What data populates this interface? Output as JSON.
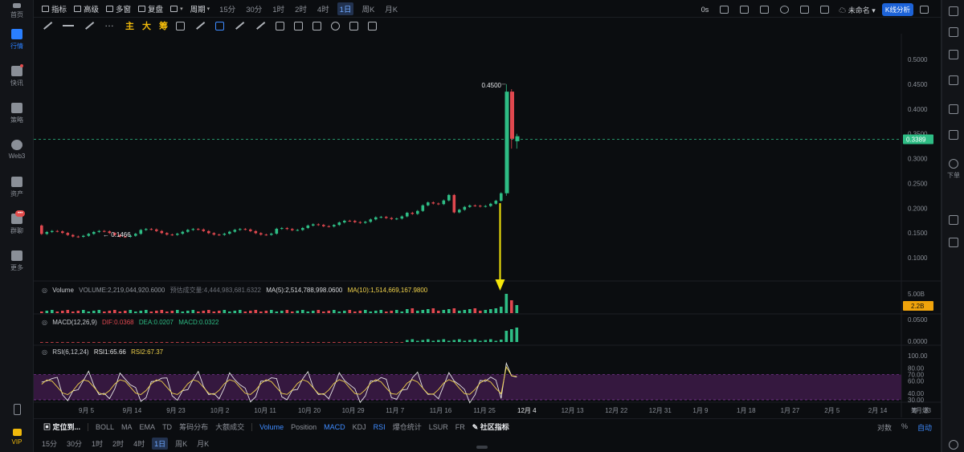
{
  "left_nav": [
    {
      "label": "首页",
      "icon": "home-icon"
    },
    {
      "label": "行情",
      "icon": "market-chart-icon",
      "active": true
    },
    {
      "label": "快讯",
      "icon": "news-icon"
    },
    {
      "label": "策略",
      "icon": "robot-icon"
    },
    {
      "label": "Web3",
      "icon": "web3-icon"
    },
    {
      "label": "资产",
      "icon": "wallet-icon"
    },
    {
      "label": "群聊",
      "icon": "chat-icon",
      "badge": "•••"
    },
    {
      "label": "更多",
      "icon": "more-grid-icon"
    },
    {
      "label": "VIP",
      "icon": "vip-crown-icon"
    }
  ],
  "toolbar": {
    "indicators": "指标",
    "advanced": "高级",
    "multi_window": "多窗",
    "replay": "复盘",
    "period": "周期",
    "timeframes": [
      "15分",
      "30分",
      "1时",
      "2时",
      "4时",
      "1日",
      "周K",
      "月K"
    ],
    "active_timeframe": "1日",
    "countdown": "0s",
    "cloud_label": "未命名",
    "kline_analysis": "K线分析"
  },
  "draw_toolbar": {
    "main": "主",
    "large": "大",
    "chips": "筹"
  },
  "right_rail": {
    "place_order": "下单"
  },
  "chart": {
    "price_axis": [
      "0.5000",
      "0.4500",
      "0.4000",
      "0.3500",
      "0.3000",
      "0.2500",
      "0.2000",
      "0.1500",
      "0.1000"
    ],
    "current_price": "0.3389",
    "high_label": "0.4500",
    "low_label": "0.1466",
    "x_axis": [
      "9月 5",
      "9月 14",
      "9月 23",
      "10月 2",
      "10月 11",
      "10月 20",
      "10月 29",
      "11月 7",
      "11月 16",
      "11月 25",
      "12月 4",
      "12月 13",
      "12月 22",
      "12月 31",
      "1月 9",
      "1月 18",
      "1月 27",
      "2月 5",
      "2月 14",
      "2月 23"
    ],
    "x_axis_active": "12月 4",
    "axis_tail": [
      "筹",
      "爆"
    ]
  },
  "volume": {
    "title": "Volume",
    "volume_text": "VOLUME:2,219,044,920.6000",
    "forecast": "预估成交量:4,444,983,681.6322",
    "ma5": "MA(5):2,514,788,998.0600",
    "ma10": "MA(10):1,514,669,167.9800",
    "axis_top": "5.00B",
    "current_tag": "2.2B"
  },
  "macd": {
    "title": "MACD(12,26,9)",
    "dif": "DIF:0.0368",
    "dea": "DEA:0.0207",
    "macd": "MACD:0.0322",
    "axis": [
      "0.0500",
      "0.0000"
    ]
  },
  "rsi": {
    "title": "RSI(6,12,24)",
    "rsi1": "RSI1:65.66",
    "rsi2": "RSI2:67.37",
    "axis": [
      "100.00",
      "80.00",
      "70.00",
      "60.00",
      "40.00",
      "30.00"
    ]
  },
  "indicator_bar": {
    "locate": "定位到...",
    "items": [
      "BOLL",
      "MA",
      "EMA",
      "TD",
      "筹码分布",
      "大额成交"
    ],
    "sub_items": [
      "Volume",
      "Position",
      "MACD",
      "KDJ",
      "RSI",
      "爆仓统计",
      "LSUR",
      "FR"
    ],
    "active_sub": [
      "Volume",
      "MACD",
      "RSI"
    ],
    "community": "社区指标",
    "right": [
      "对数",
      "%",
      "自动"
    ]
  },
  "bottom_timeframes": [
    "15分",
    "30分",
    "1时",
    "2时",
    "4时",
    "1日",
    "周K",
    "月K"
  ],
  "colors": {
    "up": "#2ebd85",
    "down": "#e0484f",
    "accent": "#3e8bff",
    "rsi_band": "#3a1a45",
    "arrow": "#f5e60a"
  }
}
